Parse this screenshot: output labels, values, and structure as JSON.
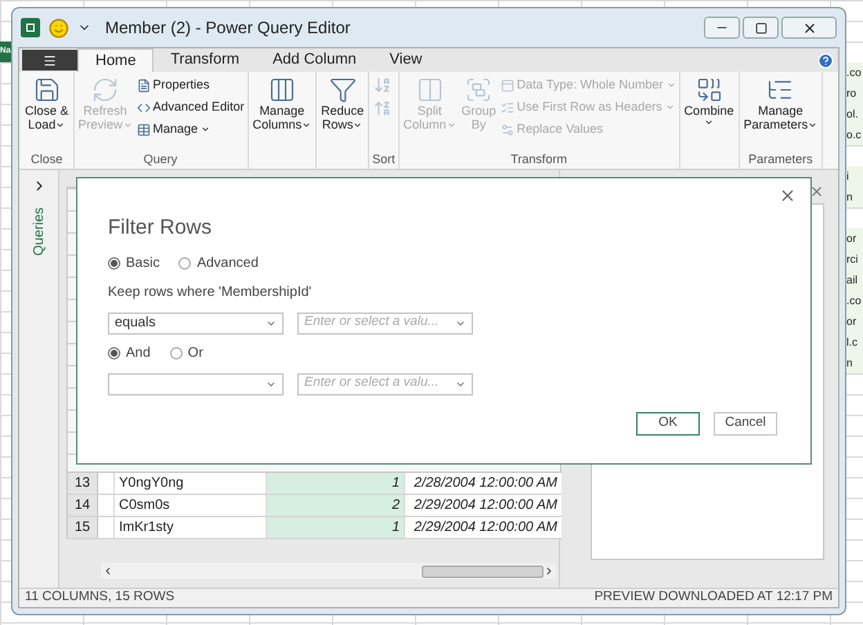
{
  "sheet": {
    "left_cells": [
      {
        "text": "Na",
        "header": true
      }
    ],
    "right_cells": [
      {
        "text": ".co"
      },
      {
        "text": "ro"
      },
      {
        "text": "ol."
      },
      {
        "text": "o.c"
      },
      {},
      {
        "text": "i"
      },
      {
        "text": "n"
      },
      {},
      {
        "text": "or"
      },
      {
        "text": "rci"
      },
      {
        "text": "ail"
      },
      {
        "text": ".co"
      },
      {
        "text": "or"
      },
      {
        "text": "l.c"
      },
      {
        "text": "n"
      }
    ]
  },
  "window": {
    "title": "Member (2) - Power Query Editor"
  },
  "tabs": [
    {
      "label": "Home",
      "selected": true
    },
    {
      "label": "Transform",
      "selected": false
    },
    {
      "label": "Add Column",
      "selected": false
    },
    {
      "label": "View",
      "selected": false
    }
  ],
  "ribbon": {
    "groups": [
      {
        "label": "Close",
        "items": [
          {
            "kind": "large",
            "lines": [
              "Close &",
              "Load"
            ],
            "dropdown": true,
            "disabled": false
          }
        ]
      },
      {
        "label": "Query",
        "items": [
          {
            "kind": "large",
            "lines": [
              "Refresh",
              "Preview"
            ],
            "dropdown": true,
            "disabled": true
          },
          {
            "kind": "stack",
            "entries": [
              {
                "label": "Properties",
                "dropdown": false,
                "disabled": false
              },
              {
                "label": "Advanced Editor",
                "dropdown": false,
                "disabled": false
              },
              {
                "label": "Manage",
                "dropdown": true,
                "disabled": false
              }
            ]
          }
        ]
      },
      {
        "items": [
          {
            "kind": "large",
            "lines": [
              "Manage",
              "Columns"
            ],
            "dropdown": true,
            "disabled": false
          }
        ]
      },
      {
        "items": [
          {
            "kind": "large",
            "lines": [
              "Reduce",
              "Rows"
            ],
            "dropdown": true,
            "disabled": false
          }
        ]
      },
      {
        "label": "Sort",
        "items": [
          {
            "kind": "sort",
            "disabled": true
          }
        ]
      },
      {
        "label": "Transform",
        "items": [
          {
            "kind": "large",
            "lines": [
              "Split",
              "Column"
            ],
            "dropdown": true,
            "disabled": true
          },
          {
            "kind": "large",
            "lines": [
              "Group",
              "By"
            ],
            "dropdown": false,
            "disabled": true
          },
          {
            "kind": "stack",
            "entries": [
              {
                "label": "Data Type: Whole Number",
                "dropdown": true,
                "disabled": true
              },
              {
                "label": "Use First Row as Headers",
                "dropdown": true,
                "disabled": true
              },
              {
                "label": "Replace Values",
                "dropdown": false,
                "disabled": true
              }
            ]
          }
        ]
      },
      {
        "items": [
          {
            "kind": "large",
            "lines": [
              "Combine"
            ],
            "dropdown": true,
            "disabled": false
          }
        ]
      },
      {
        "label": "Parameters",
        "items": [
          {
            "kind": "large",
            "lines": [
              "Manage",
              "Parameters"
            ],
            "dropdown": true,
            "disabled": false
          }
        ]
      }
    ]
  },
  "queries_pane": {
    "label": "Queries"
  },
  "grid": {
    "rows": [
      {
        "number": "13",
        "name": "Y0ngY0ng",
        "count": "1",
        "date": "2/28/2004 12:00:00 AM"
      },
      {
        "number": "14",
        "name": "C0sm0s",
        "count": "2",
        "date": "2/29/2004 12:00:00 AM"
      },
      {
        "number": "15",
        "name": "ImKr1sty",
        "count": "1",
        "date": "2/29/2004 12:00:00 AM"
      }
    ]
  },
  "status_bar": {
    "left": "11 COLUMNS, 15 ROWS",
    "right": "PREVIEW DOWNLOADED AT 12:17 PM"
  },
  "dialog": {
    "title": "Filter Rows",
    "modes": [
      {
        "label": "Basic",
        "selected": true
      },
      {
        "label": "Advanced",
        "selected": false
      }
    ],
    "prompt": "Keep rows where 'MembershipId'",
    "conditions": [
      {
        "operator": "equals",
        "placeholder": "Enter or select a valu..."
      },
      {
        "placeholder": "Enter or select a valu..."
      }
    ],
    "joiners": [
      {
        "label": "And",
        "selected": true
      },
      {
        "label": "Or",
        "selected": false
      }
    ],
    "buttons": [
      {
        "label": "OK",
        "kind": "primary"
      },
      {
        "label": "Cancel",
        "kind": "secondary"
      }
    ]
  }
}
